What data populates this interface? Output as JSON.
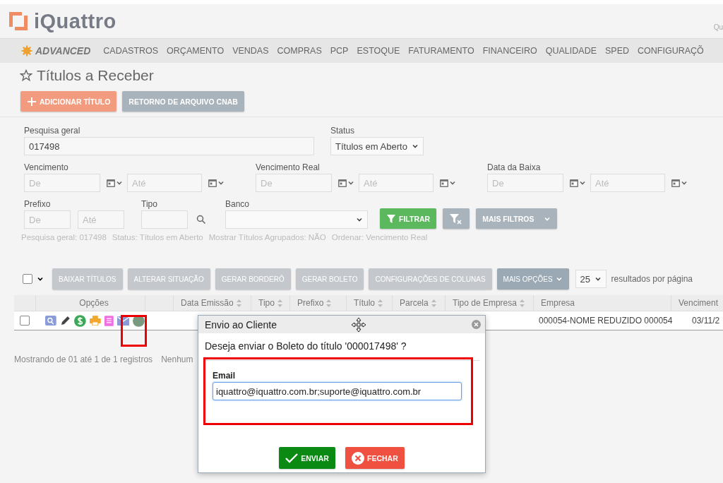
{
  "header": {
    "logo": "iQuattro",
    "user_text": "Qu"
  },
  "nav": {
    "brand": "ADVANCED",
    "items": [
      "CADASTROS",
      "ORÇAMENTO",
      "VENDAS",
      "COMPRAS",
      "PCP",
      "ESTOQUE",
      "FATURAMENTO",
      "FINANCEIRO",
      "QUALIDADE",
      "SPED",
      "CONFIGURAÇÕ"
    ]
  },
  "page_title": "Títulos a Receber",
  "actions": [
    {
      "label": "ADICIONAR TÍTULO",
      "kind": "primary"
    },
    {
      "label": "RETORNO DE ARQUIVO CNAB",
      "kind": "secondary"
    }
  ],
  "filters": {
    "search": {
      "label": "Pesquisa geral",
      "value": "017498"
    },
    "status": {
      "label": "Status",
      "value": "Títulos em Aberto"
    },
    "date_ranges": [
      {
        "label": "Vencimento",
        "from_placeholder": "De",
        "to_placeholder": "Até"
      },
      {
        "label": "Vencimento Real",
        "from_placeholder": "De",
        "to_placeholder": "Até"
      },
      {
        "label": "Data da Baixa",
        "from_placeholder": "De",
        "to_placeholder": "Até"
      }
    ],
    "prefix": {
      "label": "Prefixo",
      "from_placeholder": "De",
      "to_placeholder": "Até"
    },
    "type": {
      "label": "Tipo"
    },
    "bank": {
      "label": "Banco"
    },
    "filter_button": "FILTRAR",
    "more_filters": "MAIS FILTROS",
    "summary": [
      "Pesquisa geral: 017498",
      "Status: Títulos em Aberto",
      "Mostrar Títulos Agrupados: NÃO",
      "Ordenar: Vencimento Real"
    ]
  },
  "toolbar": {
    "select_all_checked": false,
    "buttons": [
      "BAIXAR TÍTULOS",
      "ALTERAR SITUAÇÃO",
      "GERAR BORDERÔ",
      "GERAR BOLETO",
      "CONFIGURAÇÕES DE COLUNAS"
    ],
    "more_options": "MAIS OPÇÕES",
    "page_size": "25",
    "page_size_label": "resultados por página"
  },
  "table": {
    "columns": [
      {
        "label": "Opções",
        "sortable": false
      },
      {
        "sortable": false
      },
      {
        "label": "Data Emissão",
        "sortable": true
      },
      {
        "label": "Tipo",
        "sortable": true
      },
      {
        "label": "Prefixo",
        "sortable": true
      },
      {
        "label": "Título",
        "sortable": true
      },
      {
        "label": "Parcela",
        "sortable": true
      },
      {
        "label": "Tipo de Empresa",
        "sortable": true
      },
      {
        "label": "Empresa",
        "sortable": false
      },
      {
        "label": "Venciment",
        "sortable": false
      }
    ],
    "rows": [
      {
        "checked": false,
        "empresa": "000054-NOME REDUZIDO 000054",
        "vencimento": "03/11/2"
      }
    ]
  },
  "footer": {
    "showing": "Mostrando de 01 até 1 de 1 registros",
    "extra": "Nenhum"
  },
  "dialog": {
    "title": "Envio ao Cliente",
    "question": "Deseja enviar o Boleto do título '000017498' ?",
    "email_label": "Email",
    "email_value": "iquattro@iquattro.com.br;suporte@iquattro.com.br",
    "send": "ENVIAR",
    "close": "FECHAR"
  }
}
